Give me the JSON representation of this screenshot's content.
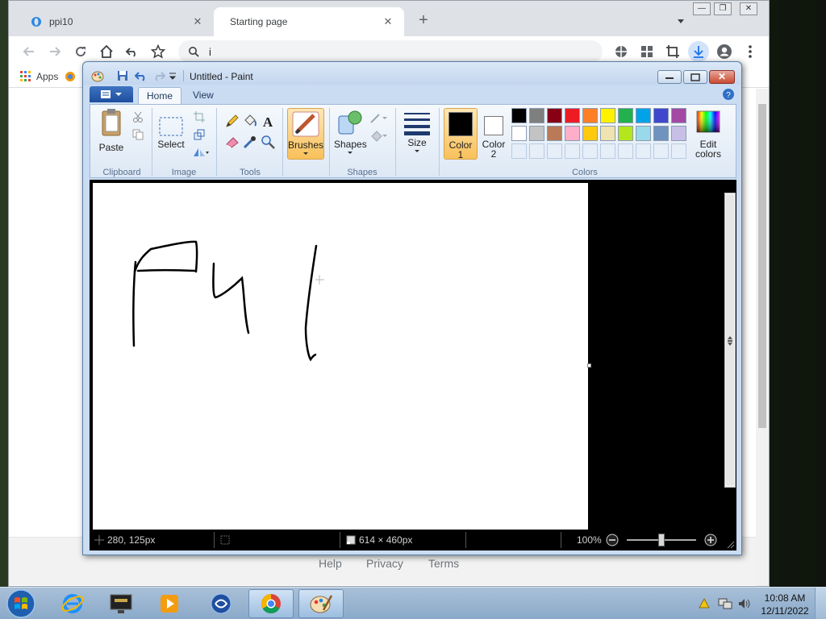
{
  "browser": {
    "tabs": [
      {
        "title": "ppi10",
        "active": false
      },
      {
        "title": "Starting page",
        "active": true
      }
    ],
    "address_text": "i",
    "bookmarks": {
      "apps_label": "Apps"
    },
    "footer_links": [
      "Help",
      "Privacy",
      "Terms"
    ]
  },
  "paint": {
    "window_title": "Untitled - Paint",
    "ribbon_tabs": [
      "Home",
      "View"
    ],
    "active_tab": "Home",
    "groups": {
      "clipboard": {
        "label": "Clipboard",
        "paste": "Paste"
      },
      "image": {
        "label": "Image",
        "select": "Select"
      },
      "tools": {
        "label": "Tools"
      },
      "brushes": {
        "label": "Brushes"
      },
      "shapes": {
        "label": "Shapes",
        "shapes_button": "Shapes"
      },
      "size": {
        "label": "Size"
      },
      "colors": {
        "label": "Colors",
        "color1_line1": "Color",
        "color1_line2": "1",
        "color2_line1": "Color",
        "color2_line2": "2",
        "edit_line1": "Edit",
        "edit_line2": "colors"
      }
    },
    "color1": "#000000",
    "color2": "#ffffff",
    "palette_row1": [
      "#000000",
      "#7f7f7f",
      "#880015",
      "#ed1c24",
      "#ff7f27",
      "#fff200",
      "#22b14c",
      "#00a2e8",
      "#3f48cc",
      "#a349a4"
    ],
    "palette_row2": [
      "#ffffff",
      "#c3c3c3",
      "#b97a57",
      "#ffaec9",
      "#ffc90e",
      "#efe4b0",
      "#b5e61d",
      "#99d9ea",
      "#7092be",
      "#c8bfe7"
    ],
    "canvas_text_drawn": "Ful",
    "status": {
      "cursor_pos": "280, 125px",
      "canvas_size": "614 × 460px",
      "zoom": "100%",
      "zoom_level": 0.5
    }
  },
  "taskbar": {
    "time": "10:08 AM",
    "date": "12/11/2022"
  }
}
